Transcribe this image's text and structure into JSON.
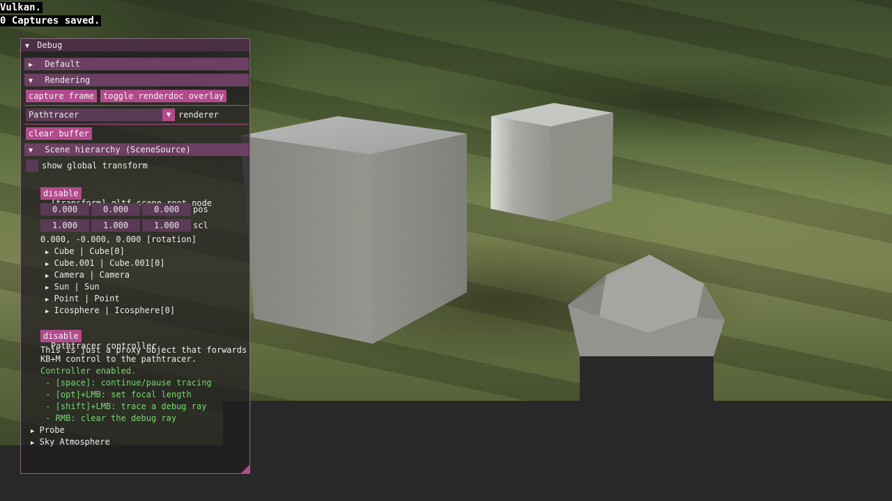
{
  "overlay": {
    "api_label": "Vulkan.",
    "captures_label": "0 Captures saved."
  },
  "window": {
    "title": "Debug"
  },
  "sections": {
    "default_label": "Default",
    "rendering_label": "Rendering",
    "scene_hierarchy_label": "Scene hierarchy (SceneSource)"
  },
  "rendering": {
    "capture_frame": "capture frame",
    "toggle_renderdoc_overlay": "toggle renderdoc overlay",
    "renderer_value": "Pathtracer",
    "renderer_label": "renderer",
    "clear_buffer": "clear buffer"
  },
  "scene": {
    "show_global_transform": "show global transform",
    "root_node": "[transform] gltf scene root node",
    "disable": "disable",
    "pos": [
      "0.000",
      "0.000",
      "0.000"
    ],
    "pos_label": "pos",
    "scl": [
      "1.000",
      "1.000",
      "1.000"
    ],
    "scl_label": "scl",
    "rotation": "0.000, -0.000, 0.000 [rotation]",
    "children": [
      "Cube | Cube[0]",
      "Cube.001 | Cube.001[0]",
      "Camera | Camera",
      "Sun | Sun",
      "Point | Point",
      "Icosphere | Icosphere[0]"
    ],
    "pathtracer_controller": "Pathtracer controller",
    "controller_disable": "disable",
    "proxy_line1": "This is just a proxy object that forwards",
    "proxy_line2": "KB+M control to the pathtracer.",
    "controller_enabled": "Controller enabled.",
    "hints": [
      " - [space]: continue/pause tracing",
      " - [opt]+LMB: set focal length",
      " - [shift]+LMB: trace a debug ray",
      " - RMB: clear the debug ray"
    ],
    "probe": "Probe",
    "sky_atmosphere": "Sky Atmosphere"
  },
  "icons": {
    "expanded": "▼",
    "collapsed": "▶"
  },
  "colors": {
    "accent": "#b34a8d",
    "header": "#6d3f63",
    "green_text": "#75d96d"
  }
}
